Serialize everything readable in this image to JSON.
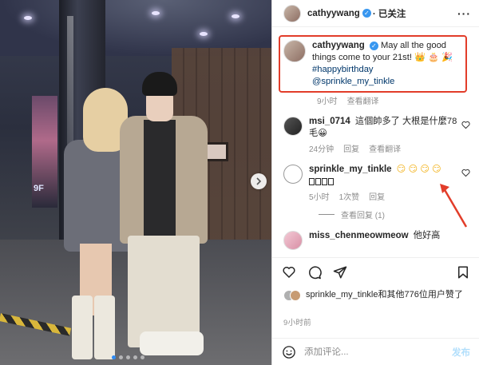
{
  "header": {
    "username": "cathyywang",
    "follow_status": "· 已关注",
    "more": "···"
  },
  "caption": {
    "username": "cathyywang",
    "text": "May all the good things come to your 21st! 👑 🎂 🎉",
    "hashtag": "#happybirthday",
    "mention": "@sprinkle_my_tinkle",
    "time": "9小时",
    "translate": "查看翻译"
  },
  "comments": [
    {
      "username": "msi_0714",
      "text": "這個帥多了 大根是什麼78毛😀",
      "time": "24分钟",
      "reply": "回复",
      "translate": "查看翻译"
    },
    {
      "username": "sprinkle_my_tinkle",
      "emojis": "😏 😏 😏 😏",
      "time": "5小时",
      "likes": "1次赞",
      "reply": "回复",
      "view_replies": "查看回复 (1)"
    },
    {
      "username": "miss_chenmeowmeow",
      "text": "他好高"
    }
  ],
  "likes": {
    "text": "sprinkle_my_tinkle和其他776位用户赞了"
  },
  "post_time": "9小时前",
  "add_comment": {
    "placeholder": "添加评论...",
    "post_label": "发布"
  },
  "photo": {
    "sign": "9F",
    "carousel_count": 5,
    "carousel_active": 0
  },
  "colors": {
    "highlight_border": "#e23d2a",
    "link": "#00376b",
    "verified": "#3897f0",
    "post_disabled": "#b2dffc"
  }
}
